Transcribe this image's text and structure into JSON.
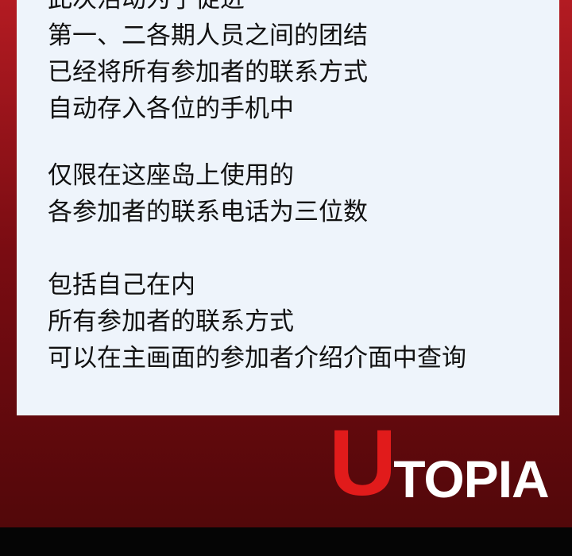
{
  "text_block_1": [
    "此次活动为了促进",
    "第一、二各期人员之间的团结",
    "已经将所有参加者的联系方式",
    "自动存入各位的手机中"
  ],
  "text_block_2": [
    "仅限在这座岛上使用的",
    "各参加者的联系电话为三位数"
  ],
  "text_block_3": [
    "包括自己在内",
    "所有参加者的联系方式",
    "可以在主画面的参加者介绍介面中查询"
  ],
  "logo": {
    "first_letter": "U",
    "rest": "TOPIA"
  },
  "colors": {
    "background_top": "#b31b22",
    "background_bottom": "#4e0709",
    "panel": "#eef4fb",
    "logo_accent": "#e11b1b",
    "logo_text": "#ffffff",
    "bottom_bar": "#050505"
  }
}
